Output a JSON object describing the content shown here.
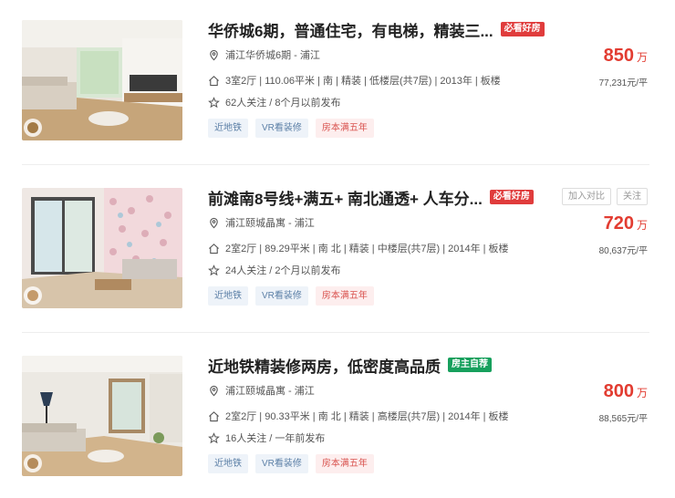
{
  "listings": [
    {
      "title": "华侨城6期，普通住宅，有电梯，精装三...",
      "badge": "必看好房",
      "location": "浦江华侨城6期 - 浦江",
      "details": "3室2厅 | 110.06平米 | 南 | 精装 | 低楼层(共7层) | 2013年 | 板楼",
      "follow": "62人关注 / 8个月以前发布",
      "tags": [
        "近地铁",
        "VR看装修",
        "房本满五年"
      ],
      "price": "850",
      "price_unit": "万",
      "unit_price": "77,231元/平"
    },
    {
      "title": "前滩南8号线+满五+ 南北通透+ 人车分...",
      "badge": "必看好房",
      "location": "浦江颐城晶寓 - 浦江",
      "details": "2室2厅 | 89.29平米 | 南 北 | 精装 | 中楼层(共7层) | 2014年 | 板楼",
      "follow": "24人关注 / 2个月以前发布",
      "tags": [
        "近地铁",
        "VR看装修",
        "房本满五年"
      ],
      "price": "720",
      "price_unit": "万",
      "unit_price": "80,637元/平",
      "actions": [
        "加入对比",
        "关注"
      ]
    },
    {
      "title": "近地铁精装修两房，低密度高品质",
      "badge": "房主自荐",
      "location": "浦江颐城晶寓 - 浦江",
      "details": "2室2厅 | 90.33平米 | 南 北 | 精装 | 高楼层(共7层) | 2014年 | 板楼",
      "follow": "16人关注 / 一年前发布",
      "tags": [
        "近地铁",
        "VR看装修",
        "房本满五年"
      ],
      "price": "800",
      "price_unit": "万",
      "unit_price": "88,565元/平"
    }
  ],
  "icons": {
    "location": "location-pin-icon",
    "house": "house-icon",
    "star": "star-icon"
  },
  "colors": {
    "price": "#e23c31",
    "badge_red": "#e03c3c",
    "badge_green": "#17a05d",
    "tag_blue_bg": "#eef3f9",
    "tag_pink_bg": "#fdeeee"
  }
}
